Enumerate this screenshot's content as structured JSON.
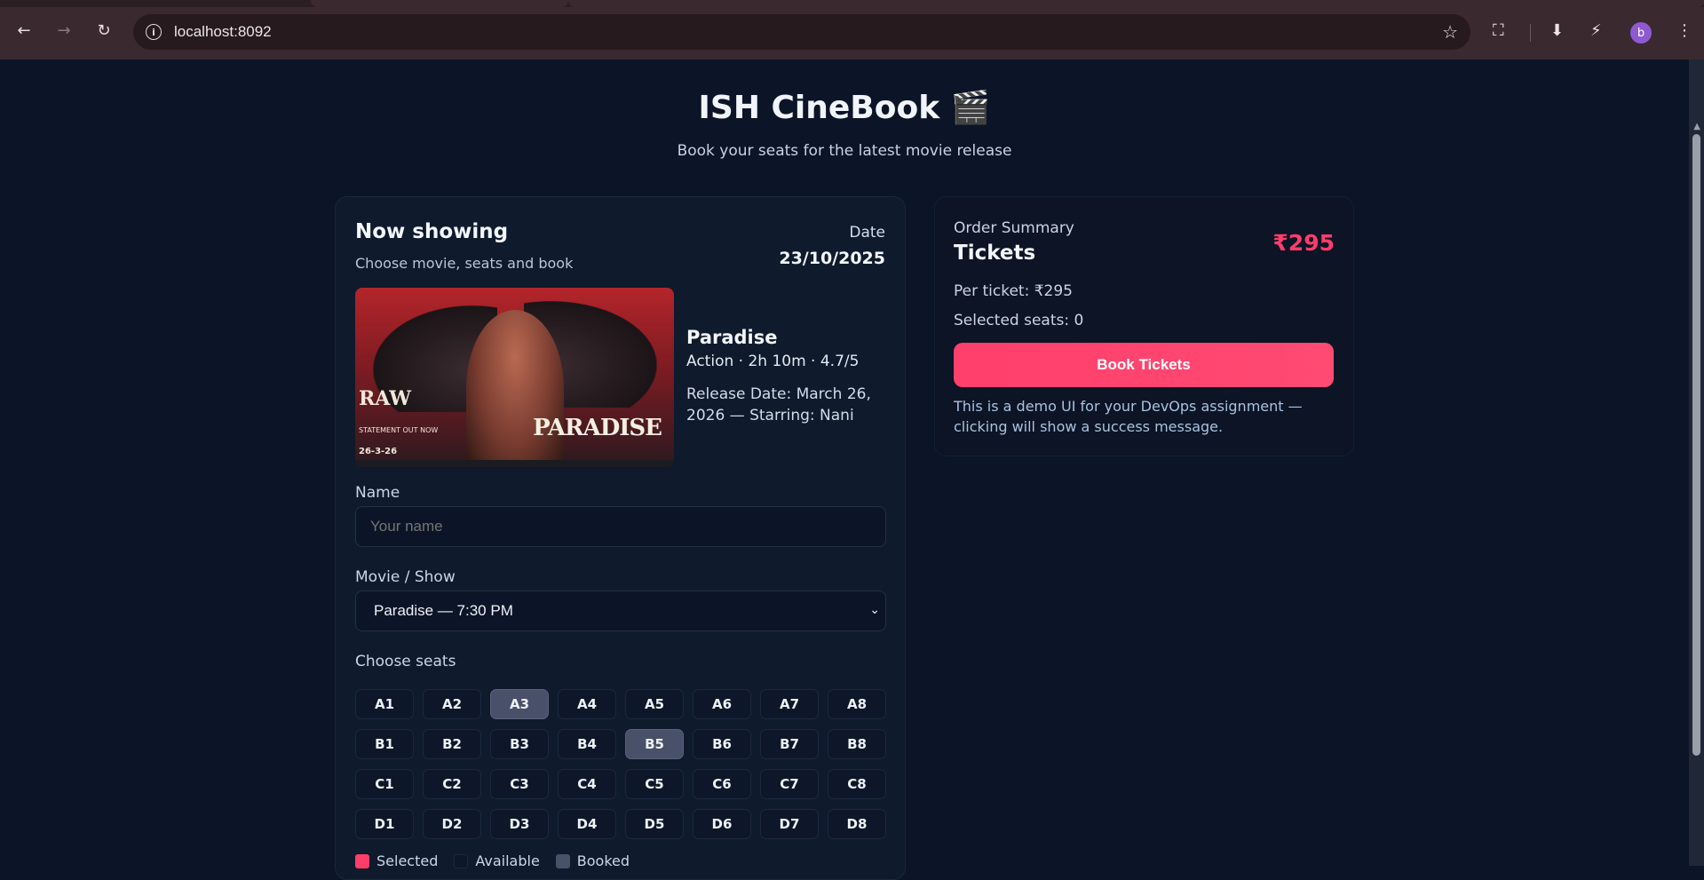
{
  "browser": {
    "url": "localhost:8092",
    "avatar_letter": "b"
  },
  "site": {
    "title": "ISH CineBook 🎬",
    "subtitle": "Book your seats for the latest movie release"
  },
  "booking": {
    "heading": "Now showing",
    "subheading": "Choose movie, seats and book",
    "date_label": "Date",
    "date_value": "23/10/2025",
    "movie": {
      "title": "Paradise",
      "meta": "Action · 2h 10m · 4.7/5",
      "release": "Release Date: March 26, 2026 — Starring: Nani",
      "poster": {
        "raw_text": "RAW",
        "raw_sub": "STATEMENT OUT NOW",
        "title_art": "PARADISE",
        "date_art": "26-3-26"
      }
    },
    "name_label": "Name",
    "name_placeholder": "Your name",
    "show_label": "Movie / Show",
    "show_value": "Paradise — 7:30 PM",
    "seats_label": "Choose seats",
    "seat_rows": [
      [
        "A1",
        "A2",
        "A3",
        "A4",
        "A5",
        "A6",
        "A7",
        "A8"
      ],
      [
        "B1",
        "B2",
        "B3",
        "B4",
        "B5",
        "B6",
        "B7",
        "B8"
      ],
      [
        "C1",
        "C2",
        "C3",
        "C4",
        "C5",
        "C6",
        "C7",
        "C8"
      ],
      [
        "D1",
        "D2",
        "D3",
        "D4",
        "D5",
        "D6",
        "D7",
        "D8"
      ]
    ],
    "booked_seats": [
      "A3",
      "B5"
    ],
    "legend": [
      {
        "label": "Selected",
        "color": "#ff3d6b"
      },
      {
        "label": "Available",
        "color": "#0d1729"
      },
      {
        "label": "Booked",
        "color": "#49506a"
      }
    ]
  },
  "summary": {
    "label": "Order Summary",
    "title": "Tickets",
    "price": "₹295",
    "per_ticket": "Per ticket: ₹295",
    "selected_seats": "Selected seats: 0",
    "button": "Book Tickets",
    "note": "This is a demo UI for your DevOps assignment — clicking will show a success message."
  },
  "colors": {
    "accent": "#ff3d6b",
    "background": "#0b1527",
    "card": "#0f1a2d"
  }
}
